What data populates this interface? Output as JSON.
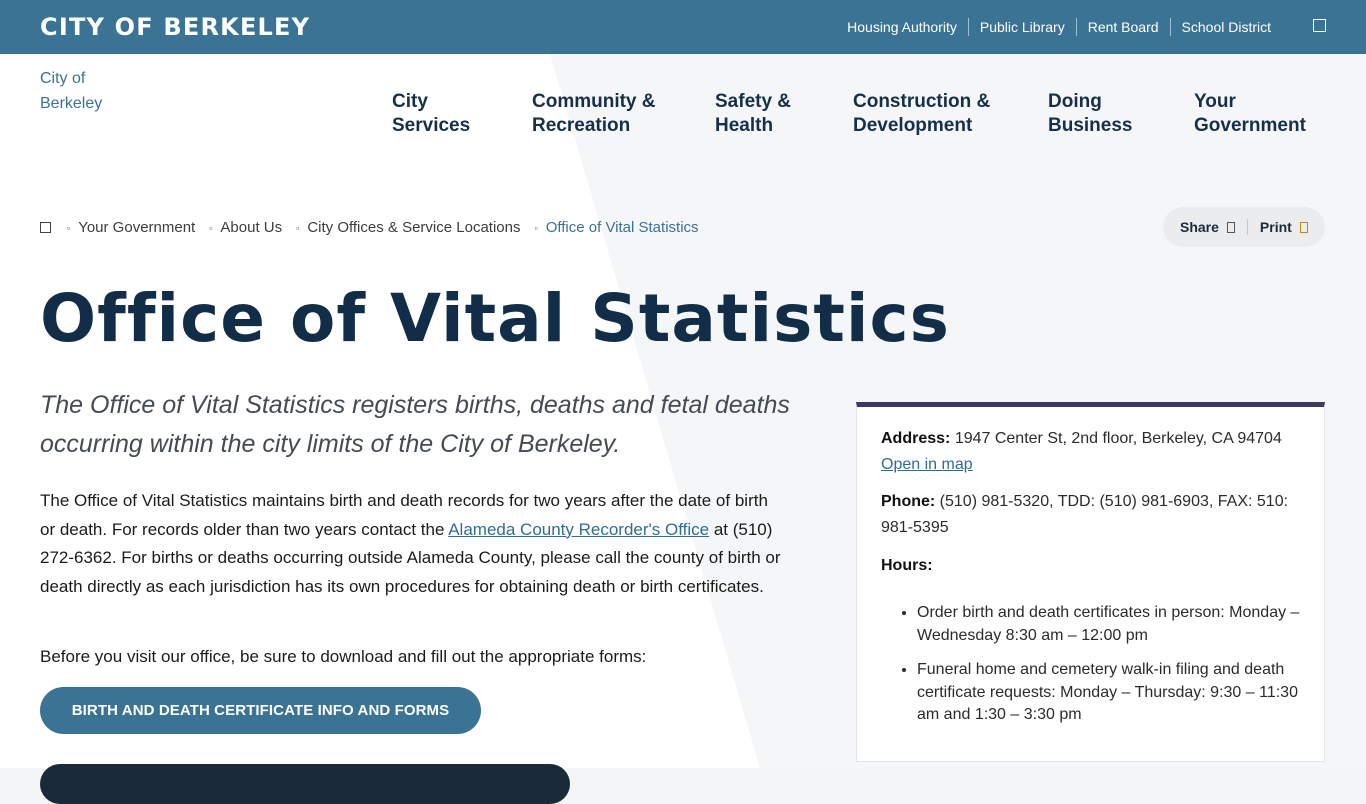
{
  "header": {
    "site_title": "CITY OF BERKELEY",
    "links": [
      "Housing Authority",
      "Public Library",
      "Rent Board",
      "School District"
    ]
  },
  "logo": {
    "alt": "City of Berkeley"
  },
  "nav": {
    "items": [
      {
        "label": "City\nServices"
      },
      {
        "label": "Community &\nRecreation"
      },
      {
        "label": "Safety &\nHealth"
      },
      {
        "label": "Construction &\nDevelopment"
      },
      {
        "label": "Doing\nBusiness"
      },
      {
        "label": "Your\nGovernment"
      }
    ]
  },
  "breadcrumb": {
    "items": [
      "Your Government",
      "About Us",
      "City Offices & Service Locations",
      "Office of Vital Statistics"
    ]
  },
  "actions": {
    "share": "Share",
    "print": "Print"
  },
  "page": {
    "title": "Office of Vital Statistics",
    "lede": "The Office of Vital Statistics registers births, deaths and fetal deaths occurring within the city limits of the City of Berkeley.",
    "para_before_link": "The Office of Vital Statistics maintains birth and death records for two years after the date of birth or death. For records older than two years contact the ",
    "para_link": "Alameda County Recorder's Office",
    "para_after_link": " at (510) 272-6362. For births or deaths occurring outside Alameda County, please call the county of birth or death directly as each jurisdiction has its own procedures for obtaining death or birth certificates.",
    "forms_note": "Before you visit our office, be sure to download and fill out the appropriate forms:",
    "button_label": "BIRTH AND DEATH CERTIFICATE INFO AND FORMS"
  },
  "card": {
    "address_label": "Address:",
    "address": "1947 Center St, 2nd floor, Berkeley, CA 94704",
    "map_link": "Open in map",
    "phone_label": "Phone:",
    "phone": "(510) 981-5320, TDD: (510) 981-6903, FAX: 510: 981-5395",
    "hours_label": "Hours:",
    "hours": [
      "Order birth and death certificates in person: Monday – Wednesday 8:30 am – 12:00 pm",
      "Funeral home and cemetery walk-in filing and death certificate requests: Monday – Thursday: 9:30 – 11:30 am and 1:30 – 3:30 pm"
    ]
  },
  "colors": {
    "brand": "#3a7393",
    "heading": "#122d47",
    "card_accent": "#3b3a63"
  }
}
